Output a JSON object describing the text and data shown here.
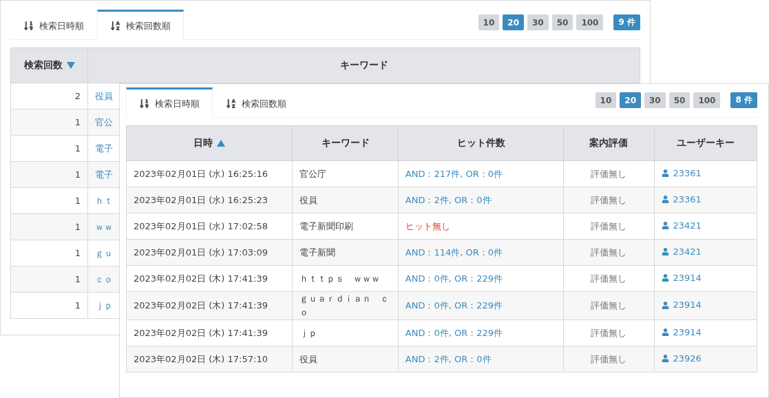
{
  "panels": [
    {
      "tabs": [
        {
          "label": "検索日時順",
          "selected": false
        },
        {
          "label": "検索回数順",
          "selected": true
        }
      ],
      "page_sizes": [
        {
          "label": "10",
          "selected": false
        },
        {
          "label": "20",
          "selected": true
        },
        {
          "label": "30",
          "selected": false
        },
        {
          "label": "50",
          "selected": false
        },
        {
          "label": "100",
          "selected": false
        }
      ],
      "total": "9 件",
      "table": {
        "columns": [
          {
            "label": "検索回数",
            "sorted": true,
            "ascending": false
          },
          {
            "label": "キーワード",
            "sorted": false
          }
        ],
        "rows": [
          [
            {
              "kind": "number",
              "text": "2"
            },
            {
              "kind": "link",
              "text": "役員"
            }
          ],
          [
            {
              "kind": "number",
              "text": "1"
            },
            {
              "kind": "link",
              "text": "官公"
            }
          ],
          [
            {
              "kind": "number",
              "text": "1"
            },
            {
              "kind": "link",
              "text": "電子"
            }
          ],
          [
            {
              "kind": "number",
              "text": "1"
            },
            {
              "kind": "link",
              "text": "電子"
            }
          ],
          [
            {
              "kind": "number",
              "text": "1"
            },
            {
              "kind": "link",
              "text": "ｈｔ"
            }
          ],
          [
            {
              "kind": "number",
              "text": "1"
            },
            {
              "kind": "link",
              "text": "ｗｗ"
            }
          ],
          [
            {
              "kind": "number",
              "text": "1"
            },
            {
              "kind": "link",
              "text": "ｇｕ"
            }
          ],
          [
            {
              "kind": "number",
              "text": "1"
            },
            {
              "kind": "link",
              "text": "ｃｏ"
            }
          ],
          [
            {
              "kind": "number",
              "text": "1"
            },
            {
              "kind": "link",
              "text": "ｊｐ"
            }
          ]
        ]
      }
    },
    {
      "tabs": [
        {
          "label": "検索日時順",
          "selected": true
        },
        {
          "label": "検索回数順",
          "selected": false
        }
      ],
      "page_sizes": [
        {
          "label": "10",
          "selected": false
        },
        {
          "label": "20",
          "selected": true
        },
        {
          "label": "30",
          "selected": false
        },
        {
          "label": "50",
          "selected": false
        },
        {
          "label": "100",
          "selected": false
        }
      ],
      "total": "8 件",
      "table": {
        "columns": [
          {
            "label": "日時",
            "sorted": true,
            "ascending": true
          },
          {
            "label": "キーワード",
            "sorted": false
          },
          {
            "label": "ヒット件数",
            "sorted": false
          },
          {
            "label": "案内評価",
            "sorted": false
          },
          {
            "label": "ユーザーキー",
            "sorted": false
          }
        ],
        "rows": [
          [
            {
              "kind": "text",
              "text": "2023年02月01日 (水) 16:25:16"
            },
            {
              "kind": "text",
              "text": "官公庁"
            },
            {
              "kind": "hits",
              "text": "AND：217件, OR：0件"
            },
            {
              "kind": "rating",
              "text": "評価無し"
            },
            {
              "kind": "user",
              "text": "23361"
            }
          ],
          [
            {
              "kind": "text",
              "text": "2023年02月01日 (水) 16:25:23"
            },
            {
              "kind": "text",
              "text": "役員"
            },
            {
              "kind": "hits",
              "text": "AND：2件, OR：0件"
            },
            {
              "kind": "rating",
              "text": "評価無し"
            },
            {
              "kind": "user",
              "text": "23361"
            }
          ],
          [
            {
              "kind": "text",
              "text": "2023年02月01日 (水) 17:02:58"
            },
            {
              "kind": "text",
              "text": "電子新聞印刷"
            },
            {
              "kind": "nohits",
              "text": "ヒット無し"
            },
            {
              "kind": "rating",
              "text": "評価無し"
            },
            {
              "kind": "user",
              "text": "23421"
            }
          ],
          [
            {
              "kind": "text",
              "text": "2023年02月01日 (水) 17:03:09"
            },
            {
              "kind": "text",
              "text": "電子新聞"
            },
            {
              "kind": "hits",
              "text": "AND：114件, OR：0件"
            },
            {
              "kind": "rating",
              "text": "評価無し"
            },
            {
              "kind": "user",
              "text": "23421"
            }
          ],
          [
            {
              "kind": "text",
              "text": "2023年02月02日 (木) 17:41:39"
            },
            {
              "kind": "text",
              "text": "ｈｔｔｐｓ　ｗｗｗ"
            },
            {
              "kind": "hits",
              "text": "AND：0件, OR：229件"
            },
            {
              "kind": "rating",
              "text": "評価無し"
            },
            {
              "kind": "user",
              "text": "23914"
            }
          ],
          [
            {
              "kind": "text",
              "text": "2023年02月02日 (木) 17:41:39"
            },
            {
              "kind": "text",
              "text": "ｇｕａｒｄｉａｎ　ｃｏ"
            },
            {
              "kind": "hits",
              "text": "AND：0件, OR：229件"
            },
            {
              "kind": "rating",
              "text": "評価無し"
            },
            {
              "kind": "user",
              "text": "23914"
            }
          ],
          [
            {
              "kind": "text",
              "text": "2023年02月02日 (木) 17:41:39"
            },
            {
              "kind": "text",
              "text": "ｊｐ"
            },
            {
              "kind": "hits",
              "text": "AND：0件, OR：229件"
            },
            {
              "kind": "rating",
              "text": "評価無し"
            },
            {
              "kind": "user",
              "text": "23914"
            }
          ],
          [
            {
              "kind": "text",
              "text": "2023年02月02日 (木) 17:57:10"
            },
            {
              "kind": "text",
              "text": "役員"
            },
            {
              "kind": "hits",
              "text": "AND：2件, OR：0件"
            },
            {
              "kind": "rating",
              "text": "評価無し"
            },
            {
              "kind": "user",
              "text": "23926"
            }
          ]
        ]
      }
    }
  ]
}
